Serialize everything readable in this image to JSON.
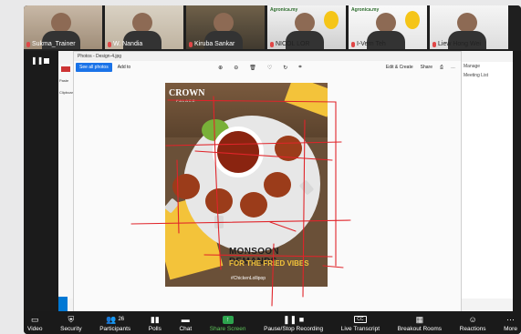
{
  "participants": [
    {
      "name": "Sukma_Trainer"
    },
    {
      "name": "W. Nandia"
    },
    {
      "name": "Kiruba Sankar"
    },
    {
      "name": "NICOL LOR"
    },
    {
      "name": "I-Vern Teh"
    },
    {
      "name": "Liew Hong Wei"
    }
  ],
  "brand_badge": "Agronica.my",
  "photos_app": {
    "title": "Photos - Design-4.jpg",
    "see_all": "See all photos",
    "add_to": "Add to",
    "edit_create": "Edit & Create",
    "share": "Share"
  },
  "poster": {
    "brand": "CROWN",
    "brand_sub": "PALACE",
    "headline": "MONSOON DEMANDS",
    "subline": "FOR THE FRIED VIBES",
    "hashtag": "#ChickenLollipop"
  },
  "background_window": {
    "right_items": [
      "Manage",
      "Meeting List"
    ],
    "left_items": [
      "Paste",
      "Clipboard"
    ]
  },
  "toolbar": {
    "items": [
      {
        "label": "Security",
        "icon": "shield-icon"
      },
      {
        "label": "Participants",
        "icon": "participants-icon",
        "count": "26"
      },
      {
        "label": "Polls",
        "icon": "polls-icon"
      },
      {
        "label": "Chat",
        "icon": "chat-icon"
      },
      {
        "label": "Share Screen",
        "icon": "share-screen-icon"
      },
      {
        "label": "Pause/Stop Recording",
        "icon": "recording-icon"
      },
      {
        "label": "Live Transcript",
        "icon": "cc-icon",
        "badge": "CC"
      },
      {
        "label": "Breakout Rooms",
        "icon": "breakout-rooms-icon"
      },
      {
        "label": "Reactions",
        "icon": "reactions-icon"
      }
    ],
    "left_cut": "Video",
    "right_cut": "More"
  },
  "colors": {
    "accent_green": "#2da44e",
    "annotation_red": "#e0242a",
    "poster_yellow": "#f3c33a"
  }
}
